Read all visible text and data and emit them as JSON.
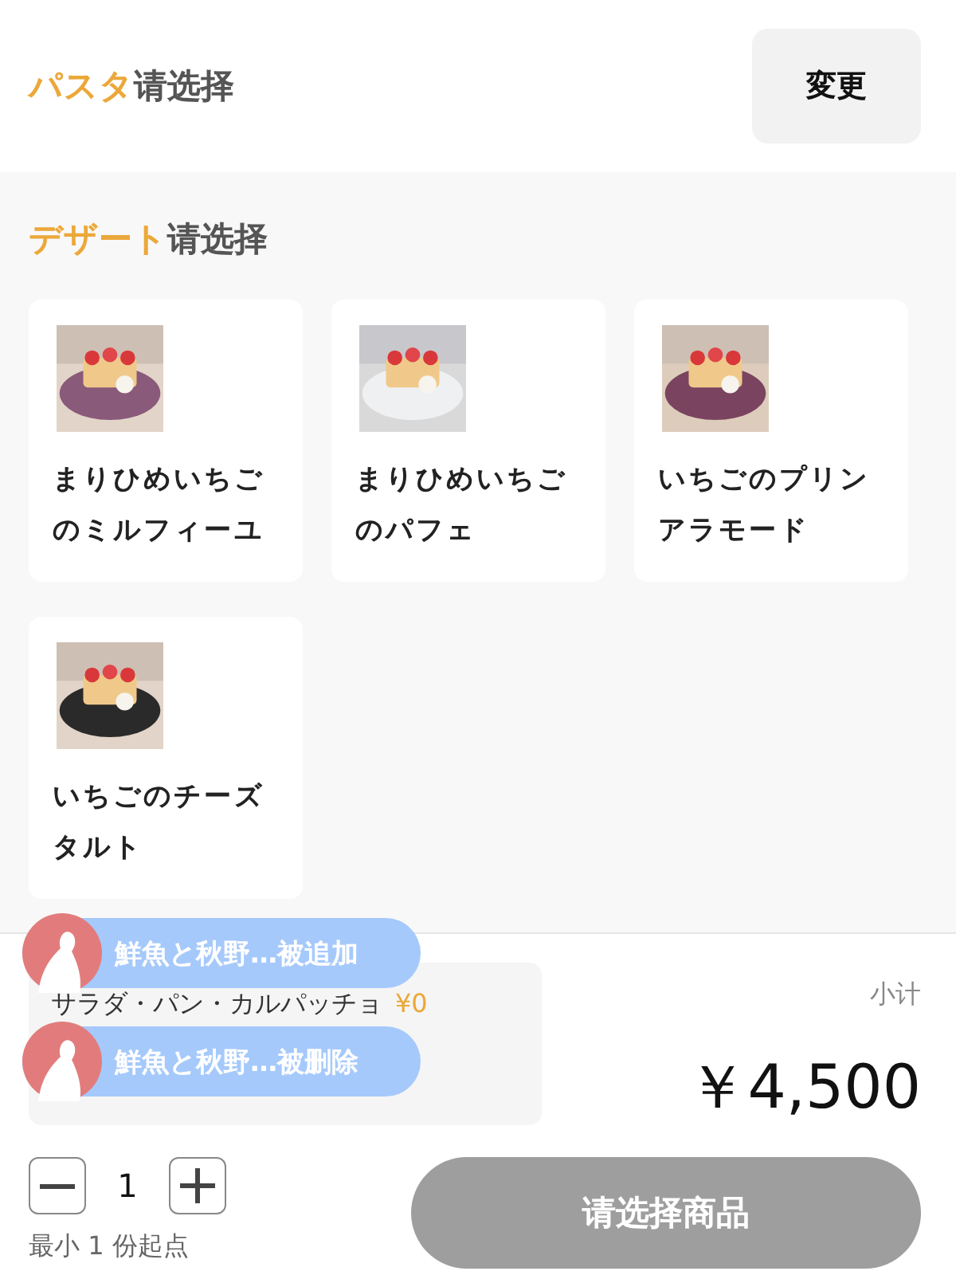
{
  "pasta_section": {
    "category": "パスタ",
    "prompt": "请选择",
    "change_button": "変更"
  },
  "dessert_section": {
    "category": "デザート",
    "prompt": "请选择",
    "items": [
      {
        "name": "まりひめいちごのミルフィーユ"
      },
      {
        "name": "まりひめいちごのパフェ"
      },
      {
        "name": "いちごのプリンアラモード"
      },
      {
        "name": "いちごのチーズタルト"
      }
    ]
  },
  "summary": {
    "line": "サラダ・パン・カルパッチョ",
    "line_price": "¥0",
    "subtotal_label": "小计",
    "total": "￥4,500"
  },
  "toasts": [
    {
      "text": "鮮魚と秋野…被追加"
    },
    {
      "text": "鮮魚と秋野…被删除"
    }
  ],
  "quantity": {
    "value": "1",
    "min_note": "最小 1 份起点"
  },
  "submit": {
    "label": "请选择商品",
    "disabled": true
  }
}
